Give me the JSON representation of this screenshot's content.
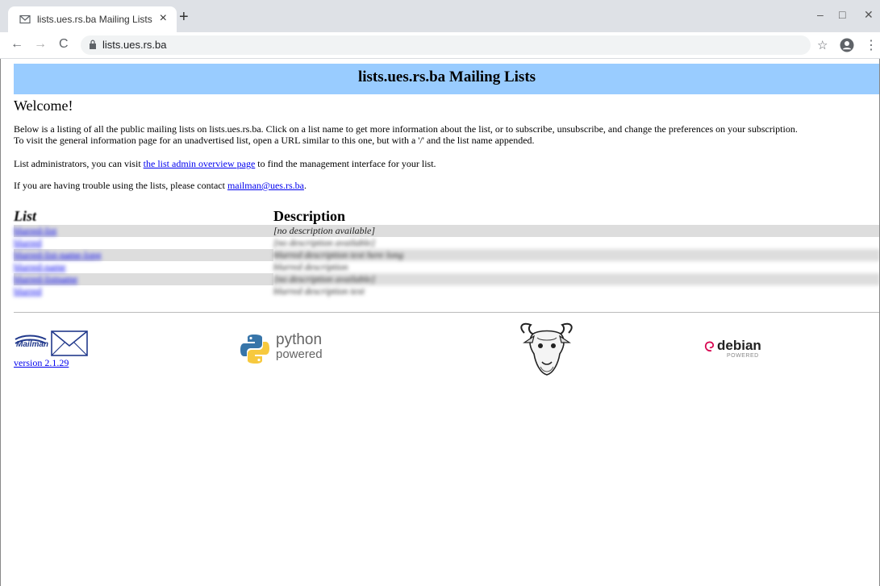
{
  "browser": {
    "tab_title": "lists.ues.rs.ba Mailing Lists",
    "tab_close": "×",
    "new_tab": "+",
    "url": "lists.ues.rs.ba",
    "minimize": "–",
    "maximize": "□",
    "close": "✕",
    "back": "←",
    "forward": "→",
    "reload": "C",
    "star": "☆",
    "menu": "⋮"
  },
  "page": {
    "banner_title": "lists.ues.rs.ba Mailing Lists",
    "welcome": "Welcome!",
    "intro_line1": "Below is a listing of all the public mailing lists on lists.ues.rs.ba. Click on a list name to get more information about the list, or to subscribe, unsubscribe, and change the preferences on your subscription.",
    "intro_line2": "To visit the general information page for an unadvertised list, open a URL similar to this one, but with a '/' and the list name appended.",
    "admin_pre": "List administrators, you can visit ",
    "admin_link": "the list admin overview page",
    "admin_post": " to find the management interface for your list.",
    "trouble_pre": "If you are having trouble using the lists, please contact ",
    "trouble_link": "mailman@ues.rs.ba",
    "trouble_post": "."
  },
  "table": {
    "col_list": "List",
    "col_desc": "Description",
    "rows": [
      {
        "name": "blurred-list",
        "desc": "[no description available]"
      },
      {
        "name": "blurred",
        "desc": "[no description available]"
      },
      {
        "name": "blurred-list-name-long",
        "desc": "blurred description text here long"
      },
      {
        "name": "blurred-name",
        "desc": "blurred description"
      },
      {
        "name": "blurred-listname",
        "desc": "[no description available]"
      },
      {
        "name": "blurred",
        "desc": "blurred description text"
      }
    ]
  },
  "footer": {
    "mailman_logo_text": "Mailman",
    "version_link": "version 2.1.29",
    "python_text1": "python",
    "python_text2": "powered",
    "debian_text": "debian",
    "debian_sub": "POWERED"
  },
  "colors": {
    "banner": "#99ccff",
    "link": "#0000ee",
    "row_shade": "#dddddd"
  }
}
